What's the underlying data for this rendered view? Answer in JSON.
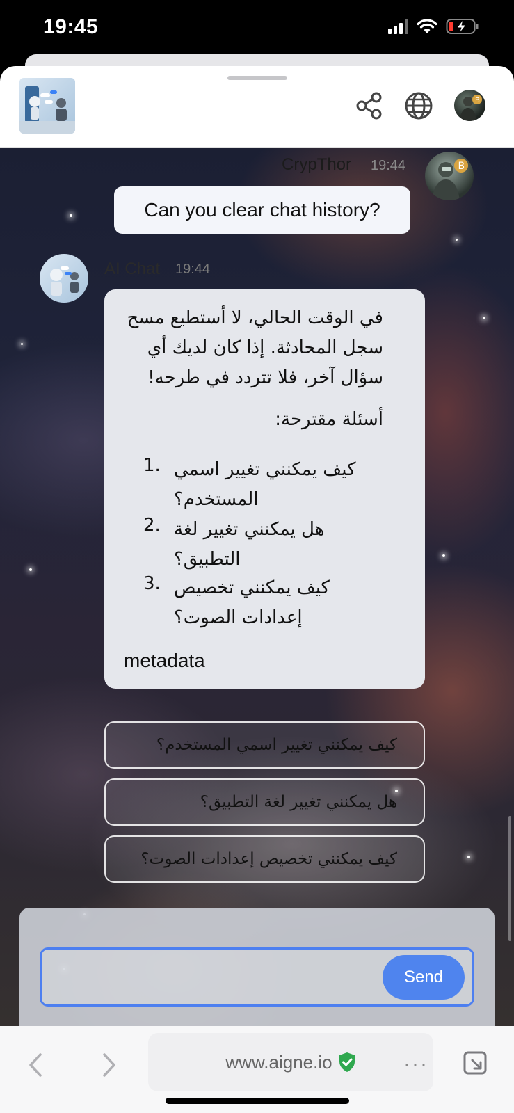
{
  "status_bar": {
    "time": "19:45"
  },
  "header": {
    "icons": [
      "share-icon",
      "globe-icon",
      "user-avatar-icon"
    ]
  },
  "chat": {
    "user_message": {
      "name": "CrypThor",
      "time": "19:44",
      "text": "Can you clear chat history?"
    },
    "ai_message": {
      "name": "AI Chat",
      "time": "19:44",
      "paragraph": "في الوقت الحالي، لا أستطيع مسح سجل المحادثة. إذا كان لديك أي سؤال آخر، فلا تتردد في طرحه!",
      "suggestions_heading": "أسئلة مقترحة:",
      "items": [
        {
          "num": "1.",
          "text": "كيف يمكنني تغيير اسمي المستخدم؟"
        },
        {
          "num": "2.",
          "text": "هل يمكنني تغيير لغة التطبيق؟"
        },
        {
          "num": "3.",
          "text": "كيف يمكنني تخصيص إعدادات الصوت؟"
        }
      ],
      "footer": "metadata"
    },
    "suggestion_buttons": [
      "كيف يمكنني تغيير اسمي المستخدم؟",
      "هل يمكنني تغيير لغة التطبيق؟",
      "كيف يمكنني تخصيص إعدادات الصوت؟"
    ]
  },
  "composer": {
    "input_value": "",
    "send_label": "Send",
    "accent": "#4f84ee"
  },
  "browser": {
    "url": "www.aigne.io",
    "more_label": "···",
    "secure_color": "#2fa84f"
  }
}
